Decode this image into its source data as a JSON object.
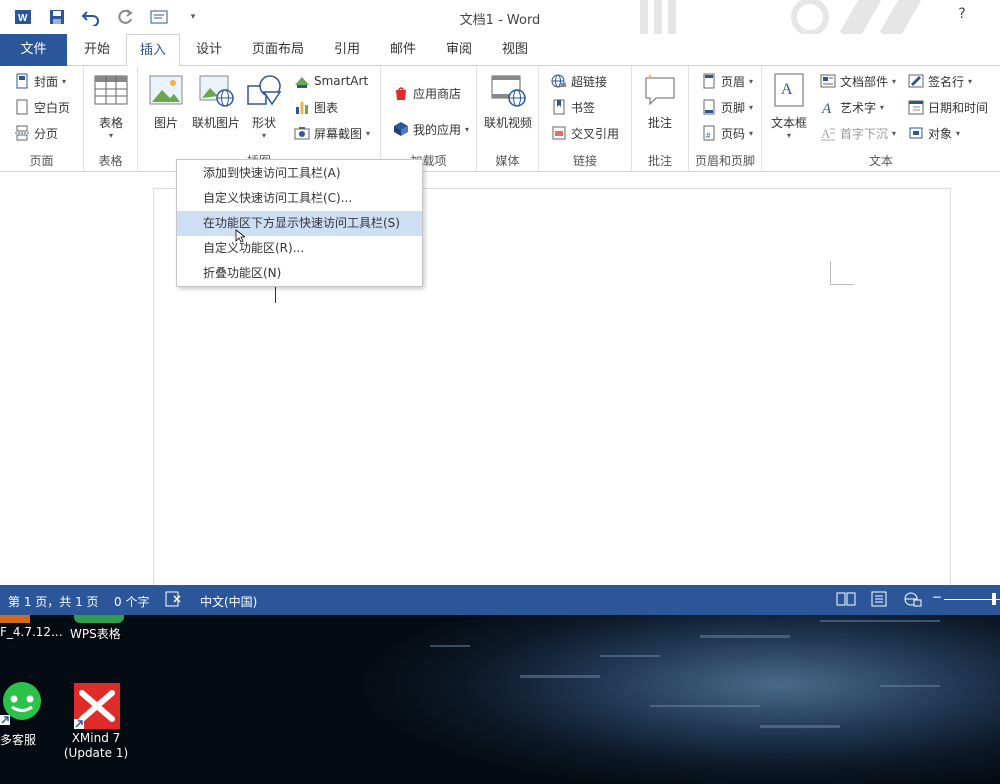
{
  "window": {
    "title": "文档1 - Word",
    "help": "?"
  },
  "tabs": [
    "文件",
    "开始",
    "插入",
    "设计",
    "页面布局",
    "引用",
    "邮件",
    "审阅",
    "视图"
  ],
  "active_tab": "插入",
  "ribbon": {
    "pages": {
      "cover": "封面",
      "blank": "空白页",
      "break": "分页",
      "label": "页面"
    },
    "tables": {
      "table": "表格",
      "label": "表格"
    },
    "illustrations": {
      "picture": "图片",
      "online_picture": "联机图片",
      "shapes": "形状",
      "smartart": "SmartArt",
      "chart": "图表",
      "screenshot": "屏幕截图",
      "label": "插图"
    },
    "addins": {
      "store": "应用商店",
      "my_apps": "我的应用",
      "label": "加载项"
    },
    "media": {
      "online_video": "联机视频",
      "label": "媒体"
    },
    "links": {
      "hyperlink": "超链接",
      "bookmark": "书签",
      "crossref": "交叉引用",
      "label": "链接"
    },
    "comments": {
      "comment": "批注",
      "label": "批注"
    },
    "header_footer": {
      "header": "页眉",
      "footer": "页脚",
      "page_number": "页码",
      "label": "页眉和页脚"
    },
    "text": {
      "textbox": "文本框",
      "quick_parts": "文档部件",
      "wordart": "艺术字",
      "dropcap": "首字下沉",
      "signature": "签名行",
      "datetime": "日期和时间",
      "object": "对象",
      "label": "文本"
    }
  },
  "context_menu": {
    "items": [
      "添加到快速访问工具栏(A)",
      "自定义快速访问工具栏(C)...",
      "在功能区下方显示快速访问工具栏(S)",
      "自定义功能区(R)...",
      "折叠功能区(N)"
    ],
    "highlighted_index": 2
  },
  "statusbar": {
    "page": "第 1 页，共 1 页",
    "words": "0 个字",
    "language": "中文(中国)"
  },
  "desktop": {
    "icons": [
      {
        "label": "F_4.7.12..."
      },
      {
        "label": "WPS表格"
      },
      {
        "label": "多客服"
      },
      {
        "label": "XMind 7\n(Update 1)"
      }
    ]
  },
  "colors": {
    "word_blue": "#2b579a",
    "menu_highlight": "#cde0f3",
    "xmind_red": "#e02b2b",
    "wechat_green": "#2bc24a"
  }
}
